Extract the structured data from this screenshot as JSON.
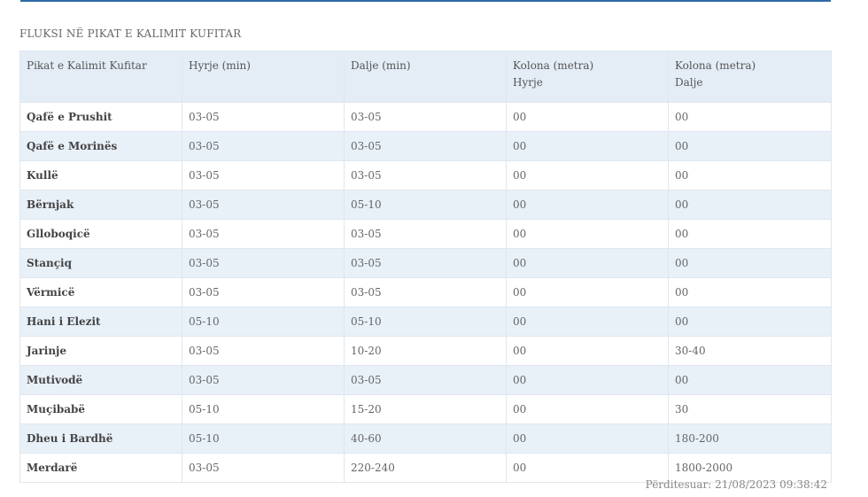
{
  "section_title": "FLUKSI NË PIKAT E KALIMIT KUFITAR",
  "table": {
    "headers": [
      {
        "line1": "Pikat e Kalimit Kufitar",
        "line2": ""
      },
      {
        "line1": "Hyrje (min)",
        "line2": ""
      },
      {
        "line1": "Dalje (min)",
        "line2": ""
      },
      {
        "line1": "Kolona (metra)",
        "line2": "Hyrje"
      },
      {
        "line1": "Kolona (metra)",
        "line2": "Dalje"
      }
    ],
    "rows": [
      [
        "Qafë e Prushit",
        "03-05",
        "03-05",
        "00",
        "00"
      ],
      [
        "Qafë e Morinës",
        "03-05",
        "03-05",
        "00",
        "00"
      ],
      [
        "Kullë",
        "03-05",
        "03-05",
        "00",
        "00"
      ],
      [
        "Bërnjak",
        "03-05",
        "05-10",
        "00",
        "00"
      ],
      [
        "Glloboqicë",
        "03-05",
        "03-05",
        "00",
        "00"
      ],
      [
        "Stançiq",
        "03-05",
        "03-05",
        "00",
        "00"
      ],
      [
        "Vërmicë",
        "03-05",
        "03-05",
        "00",
        "00"
      ],
      [
        "Hani i Elezit",
        "05-10",
        "05-10",
        "00",
        "00"
      ],
      [
        "Jarinje",
        "03-05",
        "10-20",
        "00",
        "30-40"
      ],
      [
        "Mutivodë",
        "03-05",
        "03-05",
        "00",
        "00"
      ],
      [
        "Muçibabë",
        "05-10",
        "15-20",
        "00",
        "30"
      ],
      [
        "Dheu i Bardhë",
        "05-10",
        "40-60",
        "00",
        "180-200"
      ],
      [
        "Merdarë",
        "03-05",
        "220-240",
        "00",
        "1800-2000"
      ]
    ]
  },
  "updated": "Përditesuar: 21/08/2023 09:38:42",
  "colors": {
    "accent": "#2e6aa8",
    "header_bg": "#e4edf6",
    "stripe_bg": "#e8f0f8"
  }
}
